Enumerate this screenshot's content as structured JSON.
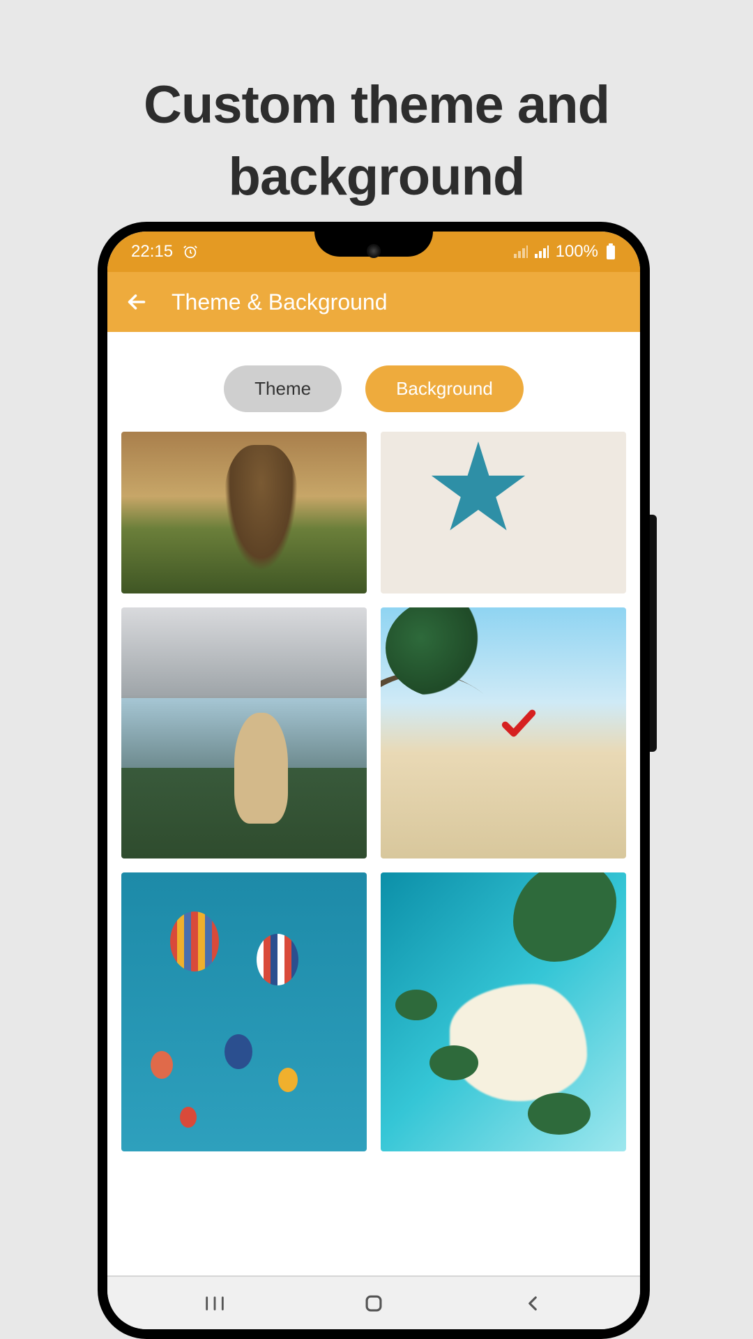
{
  "marketing": {
    "headline": "Custom theme and background"
  },
  "statusBar": {
    "time": "22:15",
    "battery": "100%"
  },
  "appBar": {
    "title": "Theme & Background"
  },
  "tabs": {
    "theme": "Theme",
    "background": "Background",
    "active": "background"
  },
  "backgrounds": [
    {
      "name": "deer",
      "selected": false
    },
    {
      "name": "star",
      "selected": false
    },
    {
      "name": "llama",
      "selected": false
    },
    {
      "name": "palm",
      "selected": true
    },
    {
      "name": "balloons",
      "selected": false
    },
    {
      "name": "aerial",
      "selected": false
    }
  ],
  "colors": {
    "accent": "#eeab3d",
    "accentDark": "#e49a23",
    "page": "#e8e8e8"
  }
}
